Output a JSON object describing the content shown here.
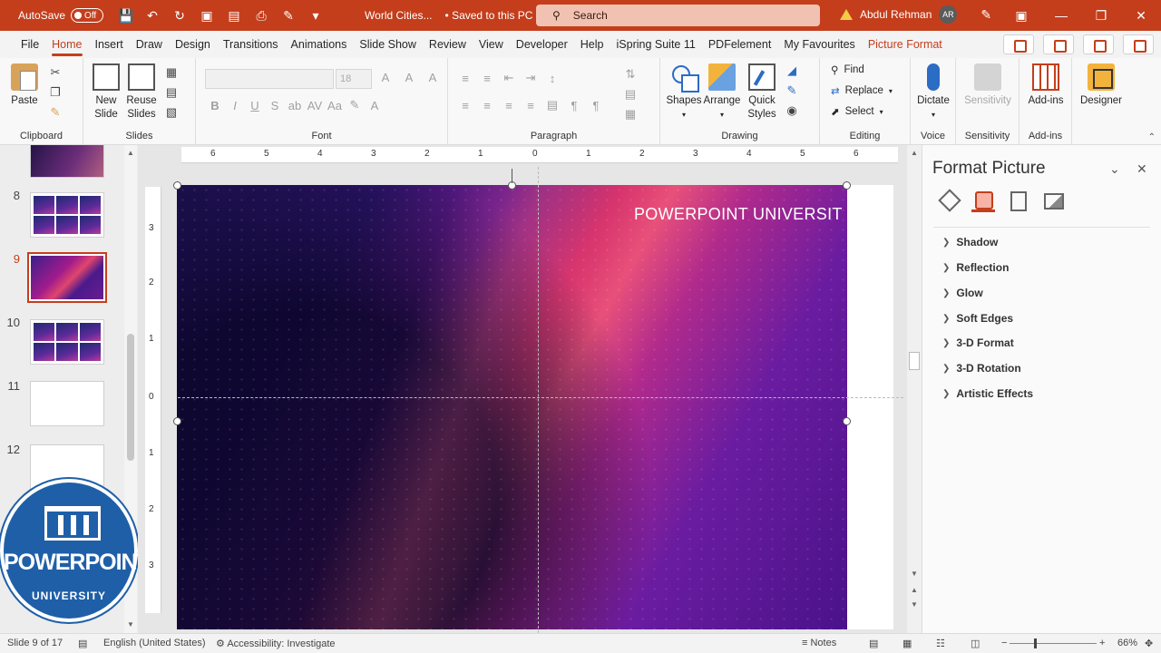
{
  "titlebar": {
    "autosave_label": "AutoSave",
    "autosave_state": "Off",
    "doc_title": "World Cities...",
    "save_status": "Saved to this PC",
    "search_placeholder": "Search",
    "user_name": "Abdul Rehman",
    "user_initials": "AR"
  },
  "tabs": [
    {
      "label": "File"
    },
    {
      "label": "Home",
      "active": true
    },
    {
      "label": "Insert"
    },
    {
      "label": "Draw"
    },
    {
      "label": "Design"
    },
    {
      "label": "Transitions"
    },
    {
      "label": "Animations"
    },
    {
      "label": "Slide Show"
    },
    {
      "label": "Review"
    },
    {
      "label": "View"
    },
    {
      "label": "Developer"
    },
    {
      "label": "Help"
    },
    {
      "label": "iSpring Suite 11"
    },
    {
      "label": "PDFelement"
    },
    {
      "label": "My Favourites"
    },
    {
      "label": "Picture Format",
      "context": true
    }
  ],
  "ribbon": {
    "clipboard": {
      "paste": "Paste",
      "group": "Clipboard"
    },
    "slides": {
      "new_slide_1": "New",
      "new_slide_2": "Slide",
      "reuse_1": "Reuse",
      "reuse_2": "Slides",
      "group": "Slides"
    },
    "font": {
      "size": "18",
      "group": "Font"
    },
    "paragraph": {
      "group": "Paragraph"
    },
    "drawing": {
      "shapes": "Shapes",
      "arrange": "Arrange",
      "quick_1": "Quick",
      "quick_2": "Styles",
      "group": "Drawing"
    },
    "editing": {
      "find": "Find",
      "replace": "Replace",
      "select": "Select",
      "group": "Editing"
    },
    "voice": {
      "dictate": "Dictate",
      "group": "Voice"
    },
    "sensitivity": {
      "label": "Sensitivity",
      "group": "Sensitivity"
    },
    "addins": {
      "label": "Add-ins",
      "group": "Add-ins"
    },
    "designer": {
      "label": "Designer"
    }
  },
  "thumbnails": {
    "items": [
      {
        "num": "8"
      },
      {
        "num": "9",
        "selected": true
      },
      {
        "num": "10"
      },
      {
        "num": "11"
      },
      {
        "num": "12"
      }
    ],
    "logo_text": "POWERPOINT",
    "logo_sub": "UNIVERSITY"
  },
  "ruler": {
    "h_ticks": [
      "6",
      "5",
      "4",
      "3",
      "2",
      "1",
      "0",
      "1",
      "2",
      "3",
      "4",
      "5",
      "6"
    ],
    "v_ticks": [
      "3",
      "2",
      "1",
      "0",
      "1",
      "2",
      "3"
    ]
  },
  "slide": {
    "caption": "POWERPOINT UNIVERSIT"
  },
  "pane": {
    "title": "Format Picture",
    "sections": [
      "Shadow",
      "Reflection",
      "Glow",
      "Soft Edges",
      "3-D Format",
      "3-D Rotation",
      "Artistic Effects"
    ]
  },
  "status": {
    "slide_info": "Slide 9 of 17",
    "language": "English (United States)",
    "accessibility": "Accessibility: Investigate",
    "notes": "Notes",
    "zoom": "66%"
  },
  "colors": {
    "accent": "#c43e1c",
    "titlebar": "#c43e1c"
  }
}
